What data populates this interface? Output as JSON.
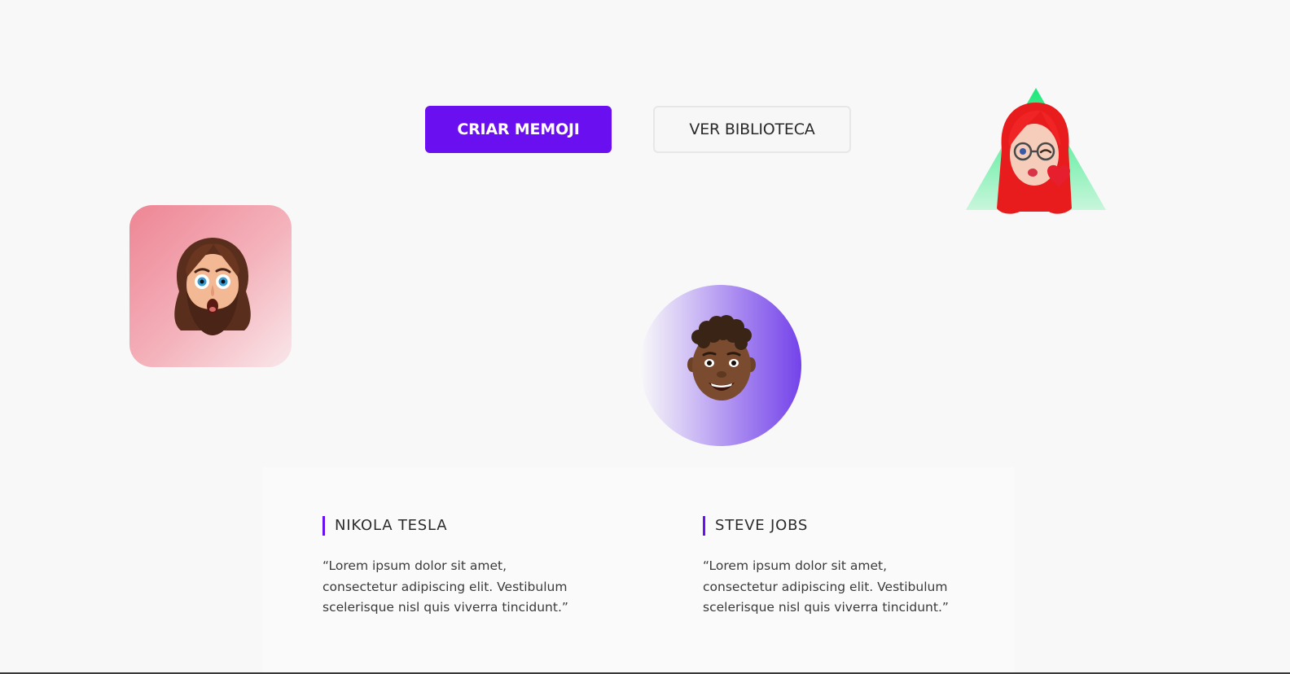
{
  "actions": {
    "primary_label": "CRIAR MEMOJI",
    "secondary_label": "VER BIBLIOTECA"
  },
  "colors": {
    "accent": "#6a0ff0",
    "square_tile_start": "#ee8594",
    "circle_tile_end": "#7443ea",
    "triangle_start": "#1ee87a",
    "background": "#f8f8f8"
  },
  "avatars": [
    {
      "name": "memoji-bearded-man",
      "tile": "rounded-square",
      "tile_color": "pink"
    },
    {
      "name": "memoji-curly-hair-boy",
      "tile": "circle",
      "tile_color": "purple"
    },
    {
      "name": "memoji-red-hair-woman",
      "tile": "triangle",
      "tile_color": "green"
    }
  ],
  "testimonials": [
    {
      "name": "NIKOLA TESLA",
      "quote": "“Lorem ipsum dolor sit amet, consectetur adipiscing elit. Vestibulum scelerisque nisl quis viverra tincidunt.”"
    },
    {
      "name": "STEVE JOBS",
      "quote": "“Lorem ipsum dolor sit amet, consectetur adipiscing elit. Vestibulum scelerisque nisl quis viverra tincidunt.”"
    }
  ]
}
